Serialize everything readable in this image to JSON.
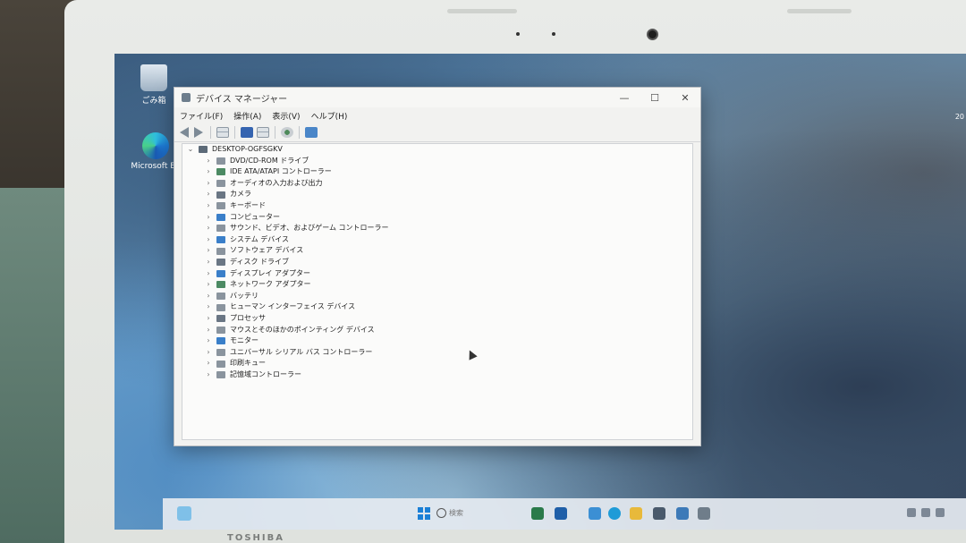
{
  "desktop": {
    "icons": [
      {
        "label": "ごみ箱"
      },
      {
        "label": "Microsoft Ed"
      }
    ],
    "corner_text": "20"
  },
  "window": {
    "title": "デバイス マネージャー",
    "controls": {
      "minimize": "—",
      "maximize": "☐",
      "close": "✕"
    },
    "menu": [
      "ファイル(F)",
      "操作(A)",
      "表示(V)",
      "ヘルプ(H)"
    ],
    "tree": {
      "root": {
        "label": "DESKTOP-OGFSGKV",
        "expanded": true
      },
      "children": [
        {
          "label": "DVD/CD-ROM ドライブ",
          "icon": "dvd-drive-icon"
        },
        {
          "label": "IDE ATA/ATAPI コントローラー",
          "icon": "ide-controller-icon"
        },
        {
          "label": "オーディオの入力および出力",
          "icon": "audio-icon"
        },
        {
          "label": "カメラ",
          "icon": "camera-icon"
        },
        {
          "label": "キーボード",
          "icon": "keyboard-icon"
        },
        {
          "label": "コンピューター",
          "icon": "computer-icon"
        },
        {
          "label": "サウンド、ビデオ、およびゲーム コントローラー",
          "icon": "sound-icon"
        },
        {
          "label": "システム デバイス",
          "icon": "system-device-icon"
        },
        {
          "label": "ソフトウェア デバイス",
          "icon": "software-device-icon"
        },
        {
          "label": "ディスク ドライブ",
          "icon": "disk-drive-icon"
        },
        {
          "label": "ディスプレイ アダプター",
          "icon": "display-adapter-icon"
        },
        {
          "label": "ネットワーク アダプター",
          "icon": "network-adapter-icon"
        },
        {
          "label": "バッテリ",
          "icon": "battery-icon"
        },
        {
          "label": "ヒューマン インターフェイス デバイス",
          "icon": "hid-icon"
        },
        {
          "label": "プロセッサ",
          "icon": "processor-icon"
        },
        {
          "label": "マウスとそのほかのポインティング デバイス",
          "icon": "mouse-icon"
        },
        {
          "label": "モニター",
          "icon": "monitor-icon"
        },
        {
          "label": "ユニバーサル シリアル バス コントローラー",
          "icon": "usb-icon"
        },
        {
          "label": "印刷キュー",
          "icon": "print-queue-icon"
        },
        {
          "label": "記憶域コントローラー",
          "icon": "storage-controller-icon"
        }
      ]
    }
  },
  "taskbar": {
    "search_label": "検索"
  },
  "bezel": {
    "brand": "TOSHIBA"
  }
}
